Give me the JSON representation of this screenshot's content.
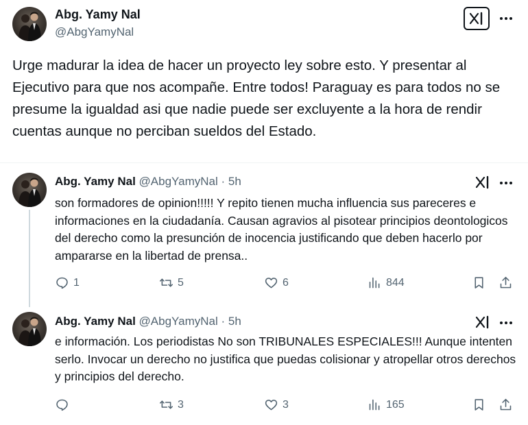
{
  "main_post": {
    "author_name": "Abg. Yamy Nal",
    "handle": "@AbgYamyNal",
    "text": "Urge madurar la idea de hacer un proyecto ley sobre esto. Y presentar al Ejecutivo para que nos acompañe. Entre todos! Paraguay es para todos no se presume la igualdad asi que nadie puede ser excluyente a la hora de rendir cuentas aunque no  perciban sueldos del Estado."
  },
  "replies": [
    {
      "author_name": "Abg. Yamy Nal",
      "handle": "@AbgYamyNal",
      "time": "· 5h",
      "text": "son formadores de opinion!!!!! Y repito tienen mucha influencia sus pareceres e informaciones en la ciudadanía. Causan agravios al pisotear principios deontologicos del derecho como la presunción de inocencia justificando que deben hacerlo por ampararse en la libertad de prensa..",
      "replies_count": "1",
      "reposts_count": "5",
      "likes_count": "6",
      "views_count": "844"
    },
    {
      "author_name": "Abg. Yamy Nal",
      "handle": "@AbgYamyNal",
      "time": "· 5h",
      "text": "e información.  Los periodistas No son TRIBUNALES ESPECIALES!!! Aunque intenten serlo. Invocar un derecho no justifica que puedas colisionar y atropellar otros derechos y principios del derecho.",
      "replies_count": "",
      "reposts_count": "3",
      "likes_count": "3",
      "views_count": "165"
    }
  ],
  "icons": {
    "grok": "grok-icon",
    "more": "more-icon",
    "reply": "reply-icon",
    "repost": "repost-icon",
    "like": "like-icon",
    "views": "views-icon",
    "bookmark": "bookmark-icon",
    "share": "share-icon"
  },
  "colors": {
    "text": "#0f1419",
    "secondary": "#536471",
    "thread_line": "#cfd9de",
    "background": "#ffffff"
  }
}
